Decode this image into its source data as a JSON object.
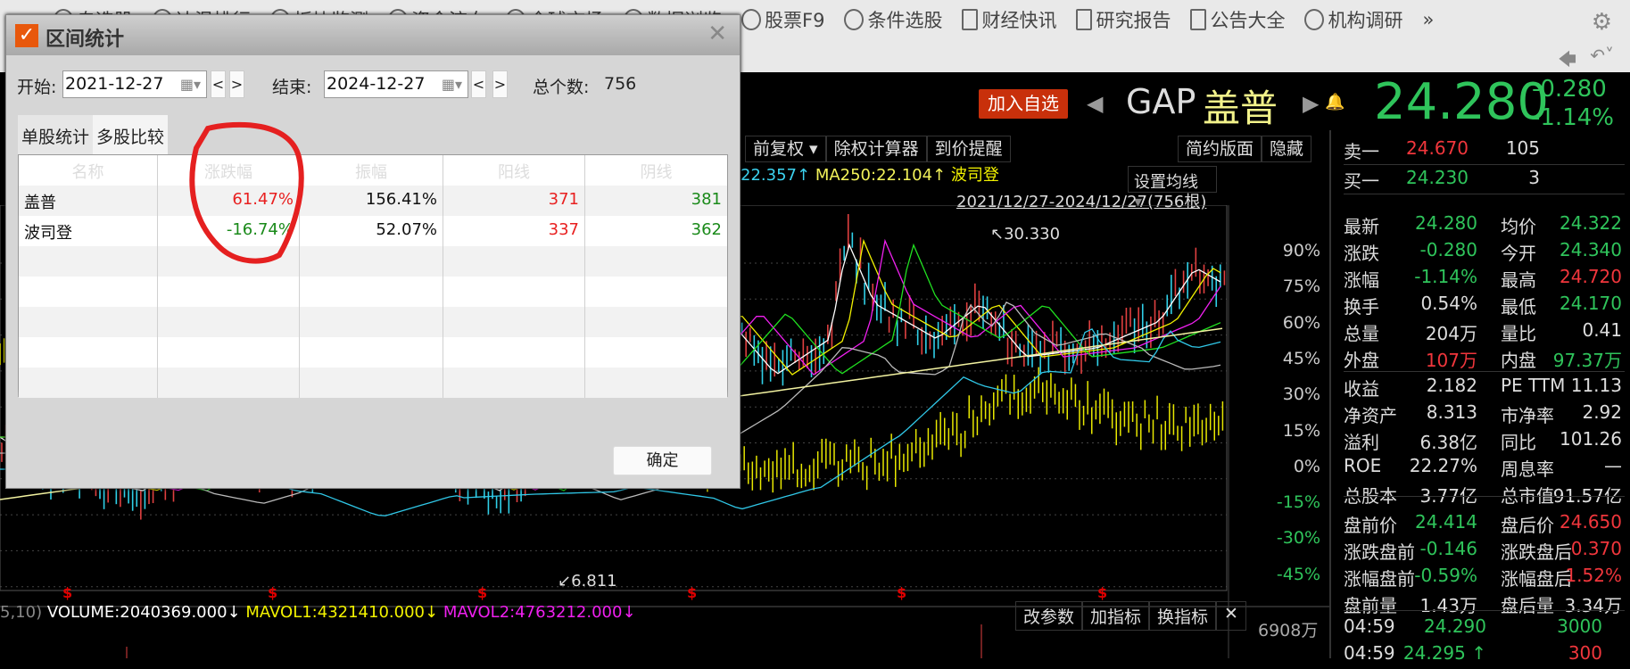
{
  "nav": {
    "items": [
      {
        "label": "自选股",
        "icon": "quote-icon"
      },
      {
        "label": "达温排行",
        "icon": "quote-icon"
      },
      {
        "label": "板块监测",
        "icon": "quote-icon"
      },
      {
        "label": "资金流向",
        "icon": "quote-icon"
      },
      {
        "label": "全球市场",
        "icon": "quote-icon"
      },
      {
        "label": "数据浏览",
        "icon": "quote-icon"
      },
      {
        "label": "股票F9",
        "icon": "quote-icon"
      },
      {
        "label": "条件选股",
        "icon": "quote-icon"
      },
      {
        "label": "财经快讯",
        "icon": "document-icon"
      },
      {
        "label": "研究报告",
        "icon": "document-icon"
      },
      {
        "label": "公告大全",
        "icon": "clipboard-icon"
      },
      {
        "label": "机构调研",
        "icon": "quote-icon"
      }
    ],
    "more": "»"
  },
  "quote": {
    "add_watch": "加入自选",
    "code": "GAP",
    "name": "盖普",
    "price": "24.280",
    "change": "-0.280",
    "change_pct": "-1.14%"
  },
  "toolbar": {
    "items": [
      "前复权",
      "除权计算器",
      "到价提醒"
    ],
    "right": [
      "简约版面",
      "隐藏"
    ]
  },
  "chart": {
    "ma_text": "22.357↑",
    "ma250": "MA250:22.104↑",
    "compare": "波司登",
    "set_ma": "设置均线",
    "range": "2021/12/27-2024/12/27(756根)",
    "high_label": "↖30.330",
    "low_label": "↙6.811",
    "y_ticks": [
      "90%",
      "75%",
      "60%",
      "45%",
      "30%",
      "15%",
      "0%",
      "-15%",
      "-30%",
      "-45%"
    ],
    "volume": "VOLUME:2040369.000↓",
    "mavol1": "MAVOL1:4321410.000↓",
    "mavol2": "MAVOL2:4763212.000↓",
    "vol_params": "5,10)",
    "vol_buttons": [
      "改参数",
      "加指标",
      "换指标"
    ],
    "vol_max": "6908万"
  },
  "panel": {
    "ask": {
      "label": "卖一",
      "price": "24.670",
      "vol": "105"
    },
    "bid": {
      "label": "买一",
      "price": "24.230",
      "vol": "3"
    },
    "rows": [
      [
        "最新",
        "24.280",
        "g",
        "均价",
        "24.322",
        "g"
      ],
      [
        "涨跌",
        "-0.280",
        "g",
        "今开",
        "24.340",
        "g"
      ],
      [
        "涨幅",
        "-1.14%",
        "g",
        "最高",
        "24.720",
        "r"
      ],
      [
        "换手",
        "0.54%",
        "w",
        "最低",
        "24.170",
        "g"
      ],
      [
        "总量",
        "204万",
        "w",
        "量比",
        "0.41",
        "w"
      ],
      [
        "外盘",
        "107万",
        "r",
        "内盘",
        "97.37万",
        "g"
      ],
      [
        "收益",
        "2.182",
        "w",
        "PE TTM",
        "11.13",
        "w"
      ],
      [
        "净资产",
        "8.313",
        "w",
        "市净率",
        "2.92",
        "w"
      ],
      [
        "溢利",
        "6.38亿",
        "w",
        "同比",
        "101.26",
        "w"
      ],
      [
        "ROE",
        "22.27%",
        "w",
        "周息率",
        "—",
        "w"
      ],
      [
        "总股本",
        "3.77亿",
        "w",
        "总市值",
        "91.57亿",
        "w"
      ],
      [
        "盘前价",
        "24.414",
        "g",
        "盘后价",
        "24.650",
        "r"
      ],
      [
        "涨跌盘前",
        "-0.146",
        "g",
        "涨跌盘后",
        "0.370",
        "r"
      ],
      [
        "涨幅盘前",
        "-0.59%",
        "g",
        "涨幅盘后",
        "1.52%",
        "r"
      ],
      [
        "盘前量",
        "1.43万",
        "w",
        "盘后量",
        "3.34万",
        "w"
      ]
    ],
    "ticks": [
      {
        "time": "04:59",
        "price": "24.290",
        "vol": "3000"
      },
      {
        "time": "04:59",
        "price": "24.295 ↑",
        "vol": "300"
      }
    ]
  },
  "dialog": {
    "title": "区间统计",
    "start_label": "开始:",
    "start": "2021-12-27",
    "end_label": "结束:",
    "end": "2024-12-27",
    "total_label": "总个数:",
    "total": "756",
    "tabs": [
      "单股统计",
      "多股比较"
    ],
    "columns": [
      "名称",
      "涨跌幅",
      "振幅",
      "阳线",
      "阴线"
    ],
    "rows": [
      [
        "盖普",
        "61.47%",
        "156.41%",
        "371",
        "381"
      ],
      [
        "波司登",
        "-16.74%",
        "52.07%",
        "337",
        "362"
      ]
    ],
    "ok": "确定"
  },
  "colors": {
    "up": "#f0363c",
    "down": "#2fc45b",
    "accent": "#c8300b"
  }
}
